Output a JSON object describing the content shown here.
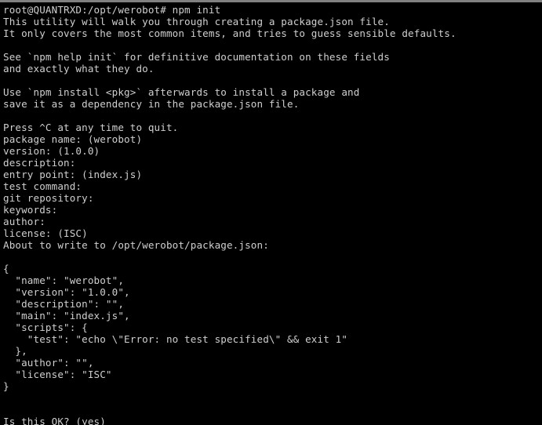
{
  "window": {
    "background_color": "#000000",
    "text_color": "#cfcfcf",
    "title_bar_color": "#808080",
    "columns": 86,
    "rows": 36
  },
  "terminal": {
    "prompt": "root@QUANTRXD:/opt/werobot#",
    "command": "npm init",
    "user": "root",
    "host": "QUANTRXD",
    "cwd": "/opt/werobot",
    "lines": [
      "root@QUANTRXD:/opt/werobot# npm init",
      "This utility will walk you through creating a package.json file.",
      "It only covers the most common items, and tries to guess sensible defaults.",
      "",
      "See `npm help init` for definitive documentation on these fields",
      "and exactly what they do.",
      "",
      "Use `npm install <pkg>` afterwards to install a package and",
      "save it as a dependency in the package.json file.",
      "",
      "Press ^C at any time to quit.",
      "package name: (werobot)",
      "version: (1.0.0)",
      "description:",
      "entry point: (index.js)",
      "test command:",
      "git repository:",
      "keywords:",
      "author:",
      "license: (ISC)",
      "About to write to /opt/werobot/package.json:",
      "",
      "{",
      "  \"name\": \"werobot\",",
      "  \"version\": \"1.0.0\",",
      "  \"description\": \"\",",
      "  \"main\": \"index.js\",",
      "  \"scripts\": {",
      "    \"test\": \"echo \\\"Error: no test specified\\\" && exit 1\"",
      "  },",
      "  \"author\": \"\",",
      "  \"license\": \"ISC\"",
      "}",
      "",
      "",
      "Is this OK? (yes)"
    ],
    "prompts": {
      "package_name": {
        "label": "package name:",
        "default": "(werobot)",
        "value": ""
      },
      "version": {
        "label": "version:",
        "default": "(1.0.0)",
        "value": ""
      },
      "description": {
        "label": "description:",
        "default": "",
        "value": ""
      },
      "entry_point": {
        "label": "entry point:",
        "default": "(index.js)",
        "value": ""
      },
      "test_command": {
        "label": "test command:",
        "default": "",
        "value": ""
      },
      "git_repository": {
        "label": "git repository:",
        "default": "",
        "value": ""
      },
      "keywords": {
        "label": "keywords:",
        "default": "",
        "value": ""
      },
      "author": {
        "label": "author:",
        "default": "",
        "value": ""
      },
      "license": {
        "label": "license:",
        "default": "(ISC)",
        "value": ""
      }
    },
    "package_json": {
      "name": "werobot",
      "version": "1.0.0",
      "description": "",
      "main": "index.js",
      "scripts": {
        "test": "echo \"Error: no test specified\" && exit 1"
      },
      "author": "",
      "license": "ISC"
    },
    "write_target": "/opt/werobot/package.json",
    "final_prompt": "Is this OK? (yes)"
  }
}
